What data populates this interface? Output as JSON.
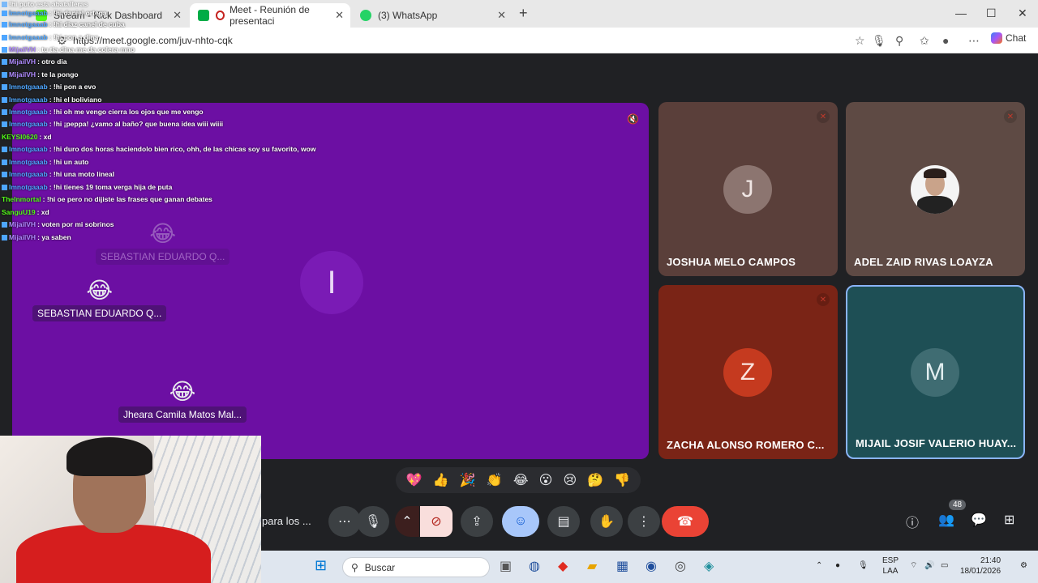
{
  "browser": {
    "tabs": [
      {
        "label": "Stream - Kick Dashboard",
        "favicon_color": "#53fc18",
        "active": false
      },
      {
        "label": "Meet - Reunión de presentaci",
        "favicon_color": "#00ac47",
        "active": true
      },
      {
        "label": "(3) WhatsApp",
        "favicon_color": "#25d366",
        "active": false
      }
    ],
    "new_tab": "+",
    "url": "https://meet.google.com/juv-nhto-cqk",
    "chat_label": "Chat",
    "window_controls": {
      "minimize": "—",
      "maximize": "☐",
      "close": "✕"
    }
  },
  "chat_overlay": [
    {
      "user": "",
      "msg": "!hi puto esta abatalleras",
      "user_color": "#9aa8ff"
    },
    {
      "user": "Imnotgaaab",
      "msg": "!hi daniel ortega",
      "user_color": "#4ea6ff"
    },
    {
      "user": "Imnotgaaab",
      "msg": "!hi diaz canel de cuba",
      "user_color": "#4ea6ff"
    },
    {
      "user": "Imnotgaaab",
      "msg": "!hi pon a dina",
      "user_color": "#4ea6ff"
    },
    {
      "user": "MijailVH",
      "msg": "tu tia dina me da colera mno",
      "user_color": "#b08bff"
    },
    {
      "user": "MijailVH",
      "msg": "otro dia",
      "user_color": "#b08bff"
    },
    {
      "user": "MijailVH",
      "msg": "te la pongo",
      "user_color": "#b08bff"
    },
    {
      "user": "Imnotgaaab",
      "msg": "!hi pon a evo",
      "user_color": "#4ea6ff"
    },
    {
      "user": "Imnotgaaab",
      "msg": "!hi el boliviano",
      "user_color": "#4ea6ff"
    },
    {
      "user": "Imnotgaaab",
      "msg": "!hi oh me vengo cierra los ojos que me vengo",
      "user_color": "#4ea6ff"
    },
    {
      "user": "Imnotgaaab",
      "msg": "!hi ¡peppa! ¿vamo al baño? que buena idea wiii wiiii",
      "user_color": "#4ea6ff"
    },
    {
      "user": "KEYSI0620",
      "msg": "xd",
      "user_color": "#53fc18"
    },
    {
      "user": "Imnotgaaab",
      "msg": "!hi duro dos horas haciendolo bien rico, ohh, de las chicas soy su favorito, wow",
      "user_color": "#4ea6ff"
    },
    {
      "user": "Imnotgaaab",
      "msg": "!hi un auto",
      "user_color": "#4ea6ff"
    },
    {
      "user": "Imnotgaaab",
      "msg": "!hi una moto lineal",
      "user_color": "#4ea6ff"
    },
    {
      "user": "Imnotgaaab",
      "msg": "!hi tienes 19 toma verga hija de puta",
      "user_color": "#4ea6ff"
    },
    {
      "user": "TheInmortal",
      "msg": "!hi oe pero no dijiste las frases que ganan debates",
      "user_color": "#53fc18"
    },
    {
      "user": "SanguU19",
      "msg": "xd",
      "user_color": "#53fc18"
    },
    {
      "user": "MijailVH",
      "msg": "voten por mi sobrinos",
      "user_color": "#b08bff"
    },
    {
      "user": "MijailVH",
      "msg": "ya saben",
      "user_color": "#b08bff"
    }
  ],
  "main_tile": {
    "initial": "I",
    "bg": "#6c0fa3"
  },
  "reactions": [
    {
      "emoji": "😂",
      "name": "SEBASTIAN EDUARDO Q...",
      "faded": true
    },
    {
      "emoji": "😂",
      "name": "SEBASTIAN EDUARDO Q...",
      "faded": false
    },
    {
      "emoji": "😂",
      "name": "Jheara Camila Matos Mal...",
      "faded": false
    }
  ],
  "participants": [
    {
      "initial": "J",
      "name": "JOSHUA MELO CAMPOS",
      "bg": "#5a3f3a",
      "avatar_bg": "#8c7570",
      "muted": true
    },
    {
      "initial": "",
      "name": "ADEL ZAID RIVAS LOAYZA",
      "bg": "#5e4a44",
      "avatar_bg": "#f4f4f4",
      "muted": true
    },
    {
      "initial": "Z",
      "name": "ZACHA ALONSO ROMERO C...",
      "bg": "#7a2416",
      "avatar_bg": "#c53a1f",
      "muted": true
    },
    {
      "initial": "M",
      "name": "MIJAIL JOSIF VALERIO HUAY...",
      "bg": "#1e4f55",
      "avatar_bg": "#3f6c72",
      "muted": false
    }
  ],
  "reaction_bar": [
    "💖",
    "👍",
    "🎉",
    "👏",
    "😂",
    "😮",
    "😢",
    "🤔",
    "👎"
  ],
  "controls": {
    "presenting_text": "para los ...",
    "participant_count": "48"
  },
  "taskbar": {
    "search_placeholder": "Buscar",
    "lang": "ESP",
    "lang_sub": "LAA",
    "time": "21:40",
    "date": "18/01/2026"
  }
}
